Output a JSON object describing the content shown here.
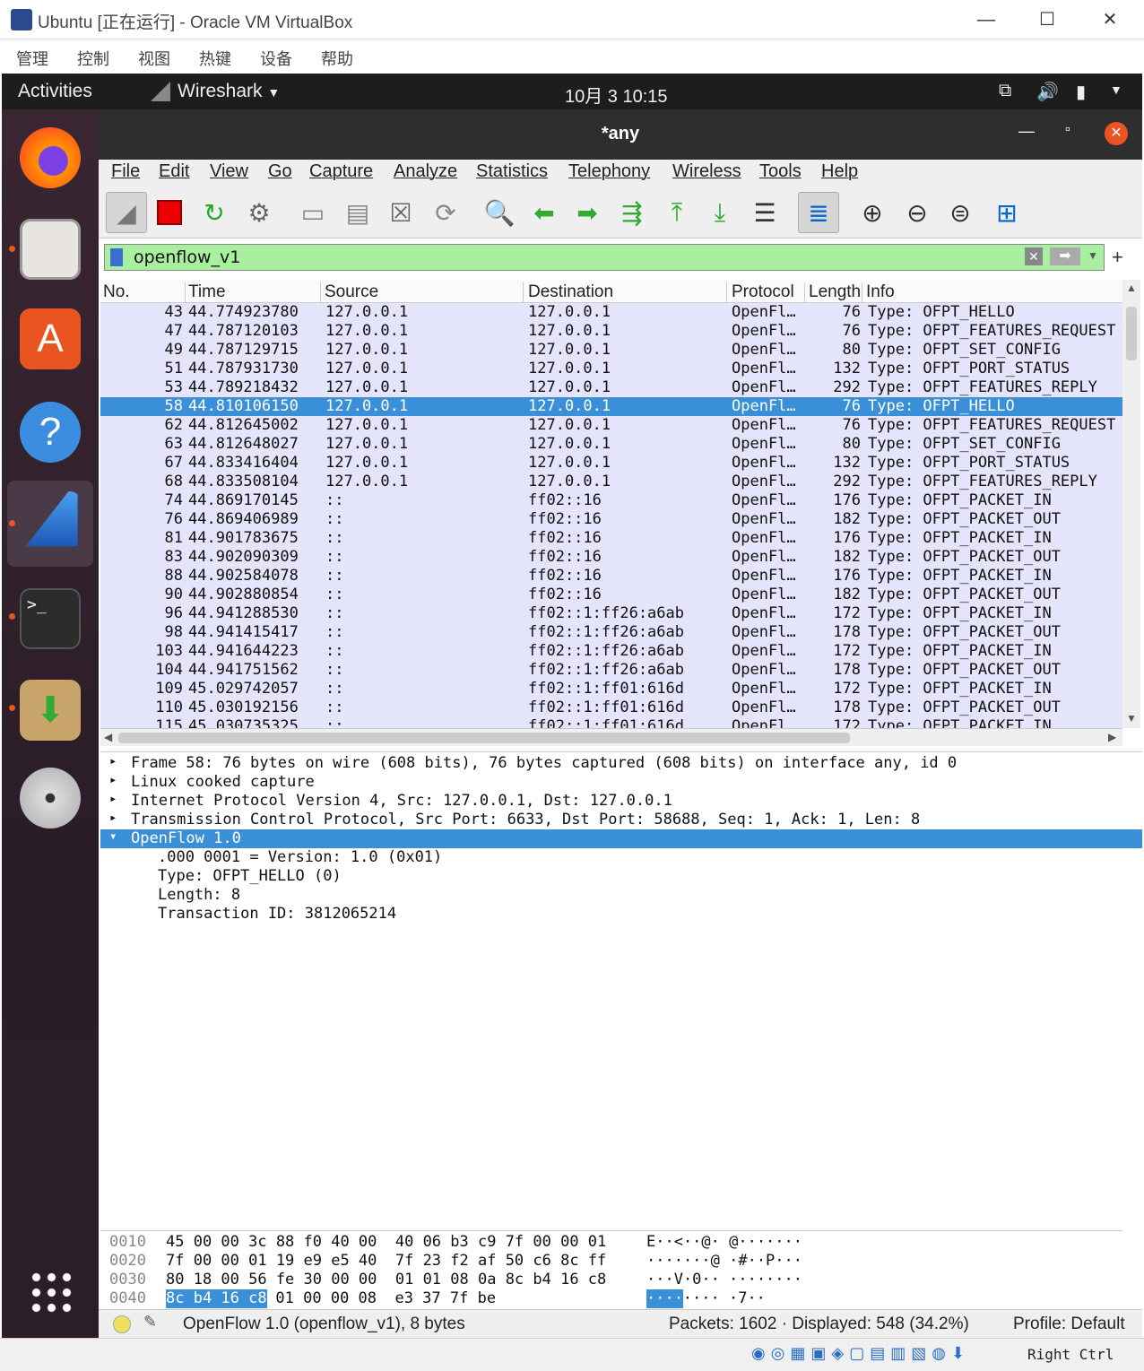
{
  "vbox": {
    "title": "Ubuntu [正在运行] - Oracle VM VirtualBox",
    "menu": [
      "管理",
      "控制",
      "视图",
      "热键",
      "设备",
      "帮助"
    ],
    "host_key": "Right Ctrl"
  },
  "topbar": {
    "activities": "Activities",
    "app": "Wireshark",
    "clock": "10月 3  10:15"
  },
  "window": {
    "title": "*any"
  },
  "menubar": [
    "File",
    "Edit",
    "View",
    "Go",
    "Capture",
    "Analyze",
    "Statistics",
    "Telephony",
    "Wireless",
    "Tools",
    "Help"
  ],
  "filter": {
    "value": "openflow_v1"
  },
  "columns": [
    "No.",
    "Time",
    "Source",
    "Destination",
    "Protocol",
    "Length",
    "Info"
  ],
  "packets": [
    [
      "43",
      "44.774923780",
      "127.0.0.1",
      "127.0.0.1",
      "OpenFl…",
      "76",
      "Type: OFPT_HELLO"
    ],
    [
      "47",
      "44.787120103",
      "127.0.0.1",
      "127.0.0.1",
      "OpenFl…",
      "76",
      "Type: OFPT_FEATURES_REQUEST"
    ],
    [
      "49",
      "44.787129715",
      "127.0.0.1",
      "127.0.0.1",
      "OpenFl…",
      "80",
      "Type: OFPT_SET_CONFIG"
    ],
    [
      "51",
      "44.787931730",
      "127.0.0.1",
      "127.0.0.1",
      "OpenFl…",
      "132",
      "Type: OFPT_PORT_STATUS"
    ],
    [
      "53",
      "44.789218432",
      "127.0.0.1",
      "127.0.0.1",
      "OpenFl…",
      "292",
      "Type: OFPT_FEATURES_REPLY"
    ],
    [
      "58",
      "44.810106150",
      "127.0.0.1",
      "127.0.0.1",
      "OpenFl…",
      "76",
      "Type: OFPT_HELLO"
    ],
    [
      "62",
      "44.812645002",
      "127.0.0.1",
      "127.0.0.1",
      "OpenFl…",
      "76",
      "Type: OFPT_FEATURES_REQUEST"
    ],
    [
      "63",
      "44.812648027",
      "127.0.0.1",
      "127.0.0.1",
      "OpenFl…",
      "80",
      "Type: OFPT_SET_CONFIG"
    ],
    [
      "67",
      "44.833416404",
      "127.0.0.1",
      "127.0.0.1",
      "OpenFl…",
      "132",
      "Type: OFPT_PORT_STATUS"
    ],
    [
      "68",
      "44.833508104",
      "127.0.0.1",
      "127.0.0.1",
      "OpenFl…",
      "292",
      "Type: OFPT_FEATURES_REPLY"
    ],
    [
      "74",
      "44.869170145",
      "::",
      "ff02::16",
      "OpenFl…",
      "176",
      "Type: OFPT_PACKET_IN"
    ],
    [
      "76",
      "44.869406989",
      "::",
      "ff02::16",
      "OpenFl…",
      "182",
      "Type: OFPT_PACKET_OUT"
    ],
    [
      "81",
      "44.901783675",
      "::",
      "ff02::16",
      "OpenFl…",
      "176",
      "Type: OFPT_PACKET_IN"
    ],
    [
      "83",
      "44.902090309",
      "::",
      "ff02::16",
      "OpenFl…",
      "182",
      "Type: OFPT_PACKET_OUT"
    ],
    [
      "88",
      "44.902584078",
      "::",
      "ff02::16",
      "OpenFl…",
      "176",
      "Type: OFPT_PACKET_IN"
    ],
    [
      "90",
      "44.902880854",
      "::",
      "ff02::16",
      "OpenFl…",
      "182",
      "Type: OFPT_PACKET_OUT"
    ],
    [
      "96",
      "44.941288530",
      "::",
      "ff02::1:ff26:a6ab",
      "OpenFl…",
      "172",
      "Type: OFPT_PACKET_IN"
    ],
    [
      "98",
      "44.941415417",
      "::",
      "ff02::1:ff26:a6ab",
      "OpenFl…",
      "178",
      "Type: OFPT_PACKET_OUT"
    ],
    [
      "103",
      "44.941644223",
      "::",
      "ff02::1:ff26:a6ab",
      "OpenFl…",
      "172",
      "Type: OFPT_PACKET_IN"
    ],
    [
      "104",
      "44.941751562",
      "::",
      "ff02::1:ff26:a6ab",
      "OpenFl…",
      "178",
      "Type: OFPT_PACKET_OUT"
    ],
    [
      "109",
      "45.029742057",
      "::",
      "ff02::1:ff01:616d",
      "OpenFl…",
      "172",
      "Type: OFPT_PACKET_IN"
    ],
    [
      "110",
      "45.030192156",
      "::",
      "ff02::1:ff01:616d",
      "OpenFl…",
      "178",
      "Type: OFPT_PACKET_OUT"
    ],
    [
      "115",
      "45.030735325",
      "::",
      "ff02::1:ff01:616d",
      "OpenFl…",
      "172",
      "Type: OFPT_PACKET_IN"
    ]
  ],
  "selected_no": "58",
  "details": [
    {
      "text": "Frame 58: 76 bytes on wire (608 bits), 76 bytes captured (608 bits) on interface any, id 0",
      "arrow": "▸",
      "indent": 0
    },
    {
      "text": "Linux cooked capture",
      "arrow": "▸",
      "indent": 0
    },
    {
      "text": "Internet Protocol Version 4, Src: 127.0.0.1, Dst: 127.0.0.1",
      "arrow": "▸",
      "indent": 0
    },
    {
      "text": "Transmission Control Protocol, Src Port: 6633, Dst Port: 58688, Seq: 1, Ack: 1, Len: 8",
      "arrow": "▸",
      "indent": 0
    },
    {
      "text": "OpenFlow 1.0",
      "arrow": "▾",
      "indent": 0,
      "selected": true
    },
    {
      "text": ".000 0001 = Version: 1.0 (0x01)",
      "arrow": "",
      "indent": 1
    },
    {
      "text": "Type: OFPT_HELLO (0)",
      "arrow": "",
      "indent": 1
    },
    {
      "text": "Length: 8",
      "arrow": "",
      "indent": 1
    },
    {
      "text": "Transaction ID: 3812065214",
      "arrow": "",
      "indent": 1
    }
  ],
  "hex": [
    {
      "off": "0010",
      "bytes": "45 00 00 3c 88 f0 40 00  40 06 b3 c9 7f 00 00 01",
      "ascii": "E··<··@· @·······"
    },
    {
      "off": "0020",
      "bytes": "7f 00 00 01 19 e9 e5 40  7f 23 f2 af 50 c6 8c ff",
      "ascii": "·······@ ·#··P···"
    },
    {
      "off": "0030",
      "bytes": "80 18 00 56 fe 30 00 00  01 01 08 0a 8c b4 16 c8",
      "ascii": "···V·0·· ········"
    },
    {
      "off": "0040",
      "bytes_hl": "8c b4 16 c8",
      "bytes": " 01 00 00 08  e3 37 7f be",
      "ascii_hl": "····",
      "ascii": "···· ·7··"
    }
  ],
  "status": {
    "message": "OpenFlow 1.0 (openflow_v1), 8 bytes",
    "packets": "Packets: 1602 · Displayed: 548 (34.2%)",
    "profile": "Profile: Default"
  }
}
